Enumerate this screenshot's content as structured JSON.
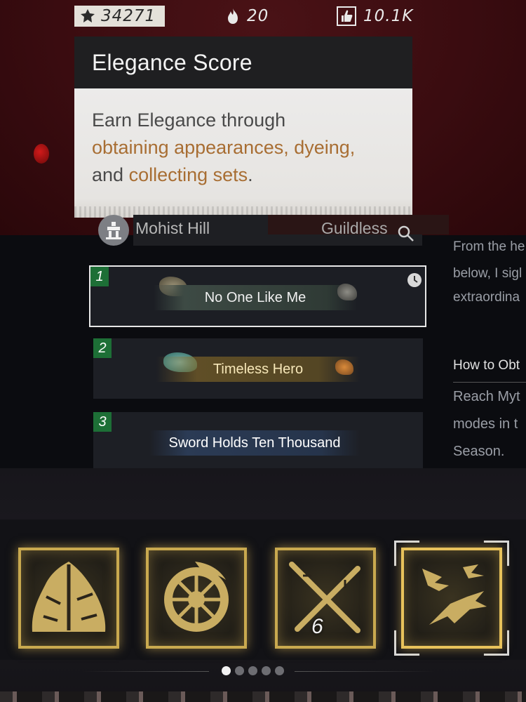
{
  "stats": {
    "elegance": "34271",
    "heat": "20",
    "likes": "10.1K"
  },
  "tooltip": {
    "title": "Elegance Score",
    "body_1": "Earn Elegance through",
    "hl_1": "obtaining appearances, dyeing,",
    "body_2": "and ",
    "hl_2": "collecting sets",
    "body_3": "."
  },
  "profile": {
    "name": "Mohist Hill",
    "guild": "Guildless"
  },
  "titles": [
    {
      "num": "1",
      "label": "No One Like Me"
    },
    {
      "num": "2",
      "label": "Timeless Hero"
    },
    {
      "num": "3",
      "label": "Sword Holds Ten Thousand"
    }
  ],
  "detail": {
    "lore_1": "From the he",
    "lore_2": "below, I sigl",
    "lore_3": "extraordina",
    "obtain_heading": "How to Obt",
    "obtain_1": "Reach Myt",
    "obtain_2": "modes in t",
    "obtain_3": "Season."
  },
  "icons": {
    "tile_1": "mountain-emblem-icon",
    "tile_2": "wheel-emblem-icon",
    "tile_3": "crossed-swords-icon",
    "tile_4": "swallows-icon",
    "tile_3_count": "6"
  },
  "colors": {
    "accent_text": "#a86e33",
    "gold": "#c9a94f",
    "rank_badge": "#1d6f36"
  }
}
